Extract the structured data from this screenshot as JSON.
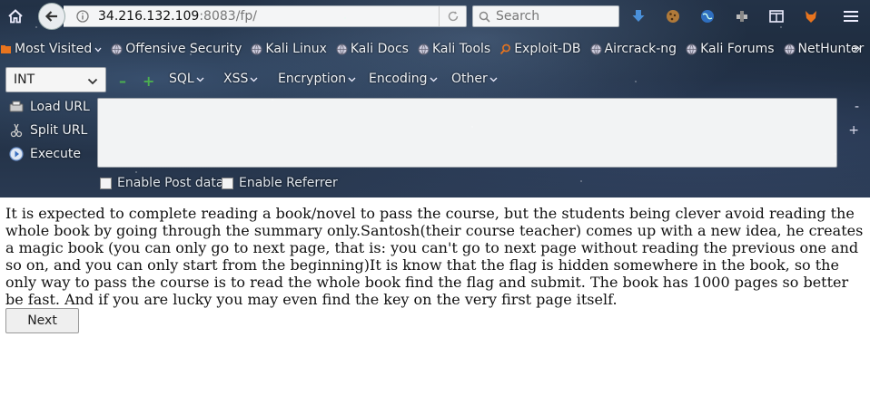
{
  "browser": {
    "url_host": "34.216.132.109",
    "url_rest": ":8083/fp/",
    "search_placeholder": "Search"
  },
  "bookmarks": {
    "items": [
      {
        "label": "Most Visited",
        "icon": "gear-folder-icon",
        "dropdown": true
      },
      {
        "label": "Offensive Security",
        "icon": "globe-icon"
      },
      {
        "label": "Kali Linux",
        "icon": "globe-icon"
      },
      {
        "label": "Kali Docs",
        "icon": "globe-icon"
      },
      {
        "label": "Kali Tools",
        "icon": "globe-icon"
      },
      {
        "label": "Exploit-DB",
        "icon": "search-icon"
      },
      {
        "label": "Aircrack-ng",
        "icon": "globe-icon"
      },
      {
        "label": "Kali Forums",
        "icon": "globe-icon"
      },
      {
        "label": "NetHunter",
        "icon": "globe-icon"
      }
    ],
    "more": "»"
  },
  "hackbar": {
    "select_value": "INT",
    "minus": "–",
    "plus": "+",
    "menus": [
      "SQL",
      "XSS",
      "Encryption",
      "Encoding",
      "Other"
    ],
    "load_url": "Load URL",
    "split_url": "Split URL",
    "execute": "Execute",
    "edge_minus": "-",
    "edge_plus": "+",
    "enable_post": "Enable Post data",
    "enable_referrer": "Enable Referrer"
  },
  "page": {
    "text": "It is expected to complete reading a book/novel to pass the course, but the students being clever avoid reading the whole book by going through the summary only.Santosh(their course teacher) comes up with a new idea, he creates a magic book (you can only go to next page, that is: you can't go to next page without reading the previous one and so on, and you can only start from the beginning)It is know that the flag is hidden somewhere in the book, so the only way to pass the course is to read the whole book find the flag and submit. The book has 1000 pages so better be fast. And if you are lucky you may even find the key on the very first page itself.",
    "next_button": "Next"
  },
  "colors": {
    "accent_green": "#4caf50",
    "chrome_bg": "#1c2a3c"
  }
}
